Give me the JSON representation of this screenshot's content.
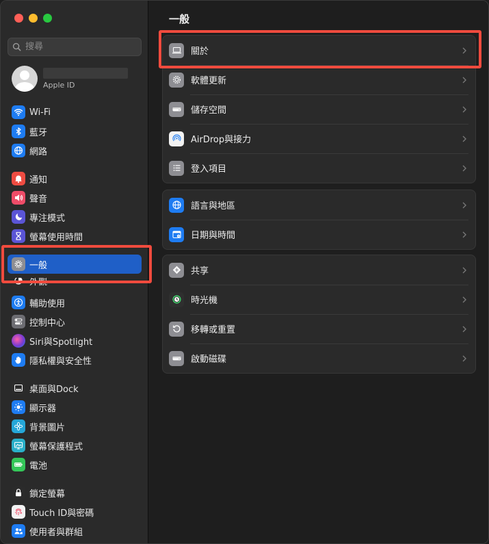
{
  "sidebar": {
    "search": {
      "placeholder": "搜尋",
      "value": ""
    },
    "account": {
      "subtitle": "Apple ID"
    },
    "items": [
      {
        "label": "Wi-Fi",
        "icon": "wifi-icon",
        "color": "#1e7cf2"
      },
      {
        "label": "藍牙",
        "icon": "bluetooth-icon",
        "color": "#1e7cf2"
      },
      {
        "label": "網路",
        "icon": "globe-icon",
        "color": "#1e7cf2"
      },
      {
        "label": "通知",
        "icon": "bell-icon",
        "color": "#ee4c42"
      },
      {
        "label": "聲音",
        "icon": "speaker-icon",
        "color": "#ee4c68"
      },
      {
        "label": "專注模式",
        "icon": "moon-icon",
        "color": "#5b55d6"
      },
      {
        "label": "螢幕使用時間",
        "icon": "hourglass-icon",
        "color": "#5b55d6"
      },
      {
        "label": "一般",
        "icon": "gear-icon",
        "color": "#8e8e93",
        "selected": true
      },
      {
        "label": "外觀",
        "icon": "appearance-icon",
        "color": "#2b2b2b"
      },
      {
        "label": "輔助使用",
        "icon": "accessibility-icon",
        "color": "#1e7cf2"
      },
      {
        "label": "控制中心",
        "icon": "control-center-icon",
        "color": "#6d6d72"
      },
      {
        "label": "Siri與Spotlight",
        "icon": "siri-icon",
        "color": "#7a3bd1"
      },
      {
        "label": "隱私權與安全性",
        "icon": "hand-icon",
        "color": "#1e7cf2"
      },
      {
        "label": "桌面與Dock",
        "icon": "dock-icon",
        "color": "#2b2b2b"
      },
      {
        "label": "顯示器",
        "icon": "sun-icon",
        "color": "#1e7cf2"
      },
      {
        "label": "背景圖片",
        "icon": "flower-icon",
        "color": "#25a7d8"
      },
      {
        "label": "螢幕保護程式",
        "icon": "screensaver-icon",
        "color": "#2ab0c9"
      },
      {
        "label": "電池",
        "icon": "battery-icon",
        "color": "#34c759"
      },
      {
        "label": "鎖定螢幕",
        "icon": "lock-icon",
        "color": "#2b2b2b"
      },
      {
        "label": "Touch ID與密碼",
        "icon": "fingerprint-icon",
        "color": "#f2f2f2"
      },
      {
        "label": "使用者與群組",
        "icon": "users-icon",
        "color": "#1e7cf2"
      }
    ]
  },
  "main": {
    "title": "一般",
    "groups": [
      [
        {
          "label": "關於",
          "icon": "laptop-icon",
          "color": "#8e8e93"
        },
        {
          "label": "軟體更新",
          "icon": "gear-badge-icon",
          "color": "#8e8e93"
        },
        {
          "label": "儲存空間",
          "icon": "drive-icon",
          "color": "#8e8e93"
        },
        {
          "label": "AirDrop與接力",
          "icon": "airdrop-icon",
          "color": "#f2f2f2"
        },
        {
          "label": "登入項目",
          "icon": "list-icon",
          "color": "#8e8e93"
        }
      ],
      [
        {
          "label": "語言與地區",
          "icon": "globe-icon",
          "color": "#1e7cf2"
        },
        {
          "label": "日期與時間",
          "icon": "calendar-icon",
          "color": "#1e7cf2"
        }
      ],
      [
        {
          "label": "共享",
          "icon": "share-icon",
          "color": "#8e8e93"
        },
        {
          "label": "時光機",
          "icon": "time-machine-icon",
          "color": "#2f2f2f"
        },
        {
          "label": "移轉或重置",
          "icon": "reset-icon",
          "color": "#8e8e93"
        },
        {
          "label": "啟動磁碟",
          "icon": "drive-icon",
          "color": "#8e8e93"
        }
      ]
    ]
  },
  "colors": {
    "accent": "#1f5fc7",
    "highlight": "#f04b3e"
  }
}
